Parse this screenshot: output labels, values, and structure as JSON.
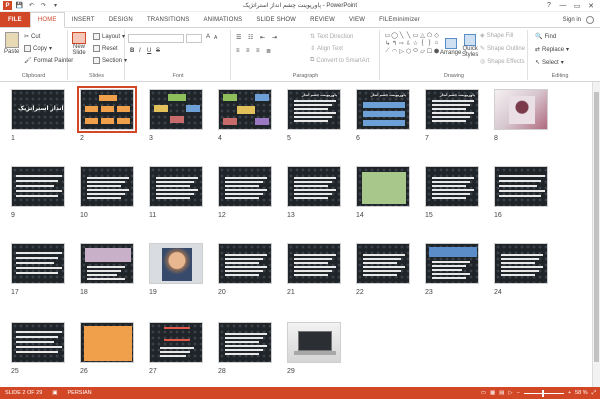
{
  "window": {
    "title": "پاورپوینت چشم انداز استراتژیک - PowerPoint",
    "help": "?",
    "minimize": "—",
    "restore": "▭",
    "close": "✕"
  },
  "qat": {
    "save": "💾",
    "undo": "↶",
    "redo": "↷",
    "customize": "▾"
  },
  "tabs": [
    "FILE",
    "HOME",
    "INSERT",
    "DESIGN",
    "TRANSITIONS",
    "ANIMATIONS",
    "SLIDE SHOW",
    "REVIEW",
    "VIEW",
    "FILEminimizer"
  ],
  "active_tab": "HOME",
  "sign_in": "Sign in",
  "ribbon": {
    "clipboard": {
      "label": "Clipboard",
      "paste": "Paste",
      "cut": "Cut",
      "copy": "Copy",
      "format_painter": "Format Painter"
    },
    "slides": {
      "label": "Slides",
      "new_slide": "New",
      "new_slide2": "Slide",
      "layout": "Layout",
      "reset": "Reset",
      "section": "Section"
    },
    "font": {
      "label": "Font",
      "bold": "B",
      "italic": "I",
      "underline": "U",
      "strike": "S",
      "size_up": "A",
      "size_down": "A"
    },
    "paragraph": {
      "label": "Paragraph",
      "text_direction": "Text Direction",
      "align_text": "Align Text",
      "smartart": "Convert to SmartArt"
    },
    "drawing": {
      "label": "Drawing",
      "arrange": "Arrange",
      "quick_styles": "Quick",
      "quick_styles2": "Styles",
      "shape_fill": "Shape Fill",
      "shape_outline": "Shape Outline",
      "shape_effects": "Shape Effects",
      "shapes": [
        "▭",
        "◯",
        "╲",
        "╲",
        "▭",
        "△",
        "⬠",
        "◇",
        "↳",
        "↰",
        "⇨",
        "⇩",
        "☆",
        "{",
        "}",
        "⌂",
        "⟋",
        "◠",
        "▷",
        "⬡",
        "⬭",
        "▱",
        "☐",
        "⬢"
      ]
    },
    "editing": {
      "label": "Editing",
      "find": "Find",
      "replace": "Replace",
      "select": "Select"
    }
  },
  "slides": [
    {
      "n": "1",
      "title": "چشم انداز استراتژیک"
    },
    {
      "n": "2",
      "title": ""
    },
    {
      "n": "3",
      "title": ""
    },
    {
      "n": "4",
      "title": ""
    },
    {
      "n": "5",
      "title": "پاورپوینت چشم انداز"
    },
    {
      "n": "6",
      "title": "پاورپوینت چشم انداز"
    },
    {
      "n": "7",
      "title": "پاورپوینت چشم انداز"
    },
    {
      "n": "8",
      "title": ""
    },
    {
      "n": "9",
      "title": ""
    },
    {
      "n": "10",
      "title": ""
    },
    {
      "n": "11",
      "title": ""
    },
    {
      "n": "12",
      "title": ""
    },
    {
      "n": "13",
      "title": ""
    },
    {
      "n": "14",
      "title": ""
    },
    {
      "n": "15",
      "title": ""
    },
    {
      "n": "16",
      "title": ""
    },
    {
      "n": "17",
      "title": ""
    },
    {
      "n": "18",
      "title": ""
    },
    {
      "n": "19",
      "title": ""
    },
    {
      "n": "20",
      "title": ""
    },
    {
      "n": "21",
      "title": ""
    },
    {
      "n": "22",
      "title": ""
    },
    {
      "n": "23",
      "title": ""
    },
    {
      "n": "24",
      "title": ""
    },
    {
      "n": "25",
      "title": ""
    },
    {
      "n": "26",
      "title": ""
    },
    {
      "n": "27",
      "title": ""
    },
    {
      "n": "28",
      "title": ""
    },
    {
      "n": "29",
      "title": ""
    }
  ],
  "selected_slide": 2,
  "status": {
    "slide": "SLIDE 2 OF 29",
    "language": "PERSIAN",
    "zoom": "58 %",
    "zoom_minus": "−",
    "zoom_plus": "+"
  },
  "colors": {
    "accent": "#d24726",
    "slide_bg": "#1f2428"
  }
}
